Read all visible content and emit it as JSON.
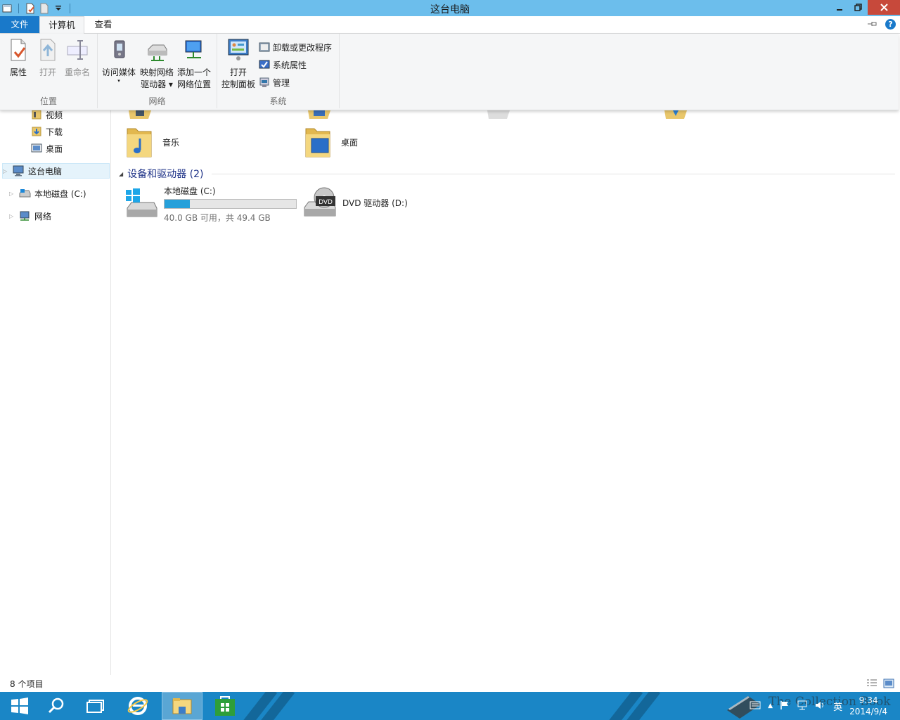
{
  "window": {
    "title": "这台电脑",
    "controls": [
      "minimize-icon",
      "restore-icon",
      "close-icon"
    ]
  },
  "ribbon_tabs": {
    "file": "文件",
    "computer": "计算机",
    "view": "查看"
  },
  "ribbon": {
    "location": {
      "label": "位置",
      "properties": "属性",
      "open": "打开",
      "rename": "重命名"
    },
    "network": {
      "label": "网络",
      "access_media": "访问媒体",
      "map_drive_line1": "映射网络",
      "map_drive_line2": "驱动器",
      "add_location_line1": "添加一个",
      "add_location_line2": "网络位置"
    },
    "system": {
      "label": "系统",
      "open_cp_line1": "打开",
      "open_cp_line2": "控制面板",
      "uninstall": "卸载或更改程序",
      "sys_props": "系统属性",
      "manage": "管理"
    }
  },
  "nav": {
    "items": [
      {
        "label": "视频"
      },
      {
        "label": "下载"
      },
      {
        "label": "桌面"
      },
      {
        "label": "这台电脑"
      },
      {
        "label": "本地磁盘 (C:)"
      },
      {
        "label": "网络"
      }
    ]
  },
  "content": {
    "folders": [
      {
        "label": "音乐"
      },
      {
        "label": "桌面"
      }
    ],
    "devices_header": "设备和驱动器 (2)",
    "drive_c": {
      "label": "本地磁盘 (C:)",
      "info": "40.0 GB 可用，共 49.4 GB",
      "used_fraction": 0.19
    },
    "drive_d": {
      "label": "DVD 驱动器 (D:)",
      "badge": "DVD"
    }
  },
  "statusbar": {
    "count": "8 个项目"
  },
  "taskbar": {
    "ime": "英",
    "time": "9:34",
    "date": "2014/9/4",
    "watermark": "The Collection Book"
  },
  "colors": {
    "titlebar": "#6cbeec",
    "file_tab": "#1979ca",
    "taskbar": "#1a86c6",
    "progress": "#26a0da",
    "close": "#c7493b"
  }
}
